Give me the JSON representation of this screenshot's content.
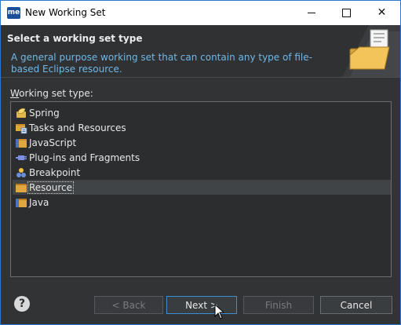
{
  "titlebar": {
    "app_icon_text": "me",
    "title": "New Working Set"
  },
  "header": {
    "title": "Select a working set type",
    "description": "A general purpose working set that can contain any type of file-based Eclipse resource."
  },
  "working_set": {
    "label_prefix": "",
    "label_mnemonic": "W",
    "label_rest": "orking set type:",
    "items": [
      {
        "label": "Spring",
        "icon": "spring-leaf-icon"
      },
      {
        "label": "Tasks and Resources",
        "icon": "tasks-folder-icon"
      },
      {
        "label": "JavaScript",
        "icon": "javascript-folder-icon"
      },
      {
        "label": "Plug-ins and Fragments",
        "icon": "plugin-icon"
      },
      {
        "label": "Breakpoint",
        "icon": "breakpoint-icon"
      },
      {
        "label": "Resource",
        "icon": "resource-folder-icon",
        "selected": true
      },
      {
        "label": "Java",
        "icon": "java-folder-icon"
      }
    ]
  },
  "buttons": {
    "help": "?",
    "back": "< Back",
    "next": "Next >",
    "finish": "Finish",
    "cancel": "Cancel"
  },
  "colors": {
    "background": "#313335",
    "accent": "#3c8fd6",
    "description_text": "#6fb8e8"
  }
}
